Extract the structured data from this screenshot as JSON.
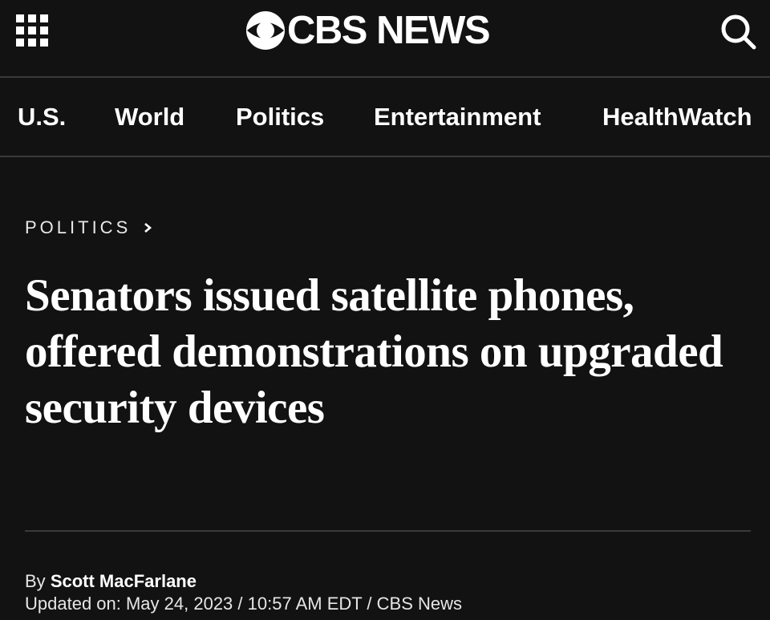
{
  "header": {
    "menu_icon": "grid-menu-icon",
    "logo_icon": "cbs-eye-icon",
    "logo_text": "CBS NEWS",
    "search_icon": "search-icon",
    "background": "#121212"
  },
  "nav": {
    "items": [
      {
        "label": "U.S."
      },
      {
        "label": "World"
      },
      {
        "label": "Politics"
      },
      {
        "label": "Entertainment"
      },
      {
        "label": "HealthWatch"
      }
    ]
  },
  "article": {
    "section": "POLITICS",
    "section_chevron_icon": "chevron-right-icon",
    "headline": "Senators issued satellite phones, offered demonstrations on upgraded security devices",
    "byline_prefix": "By",
    "author": "Scott MacFarlane",
    "updated_line": "Updated on: May 24, 2023 / 10:57 AM EDT / CBS News"
  }
}
